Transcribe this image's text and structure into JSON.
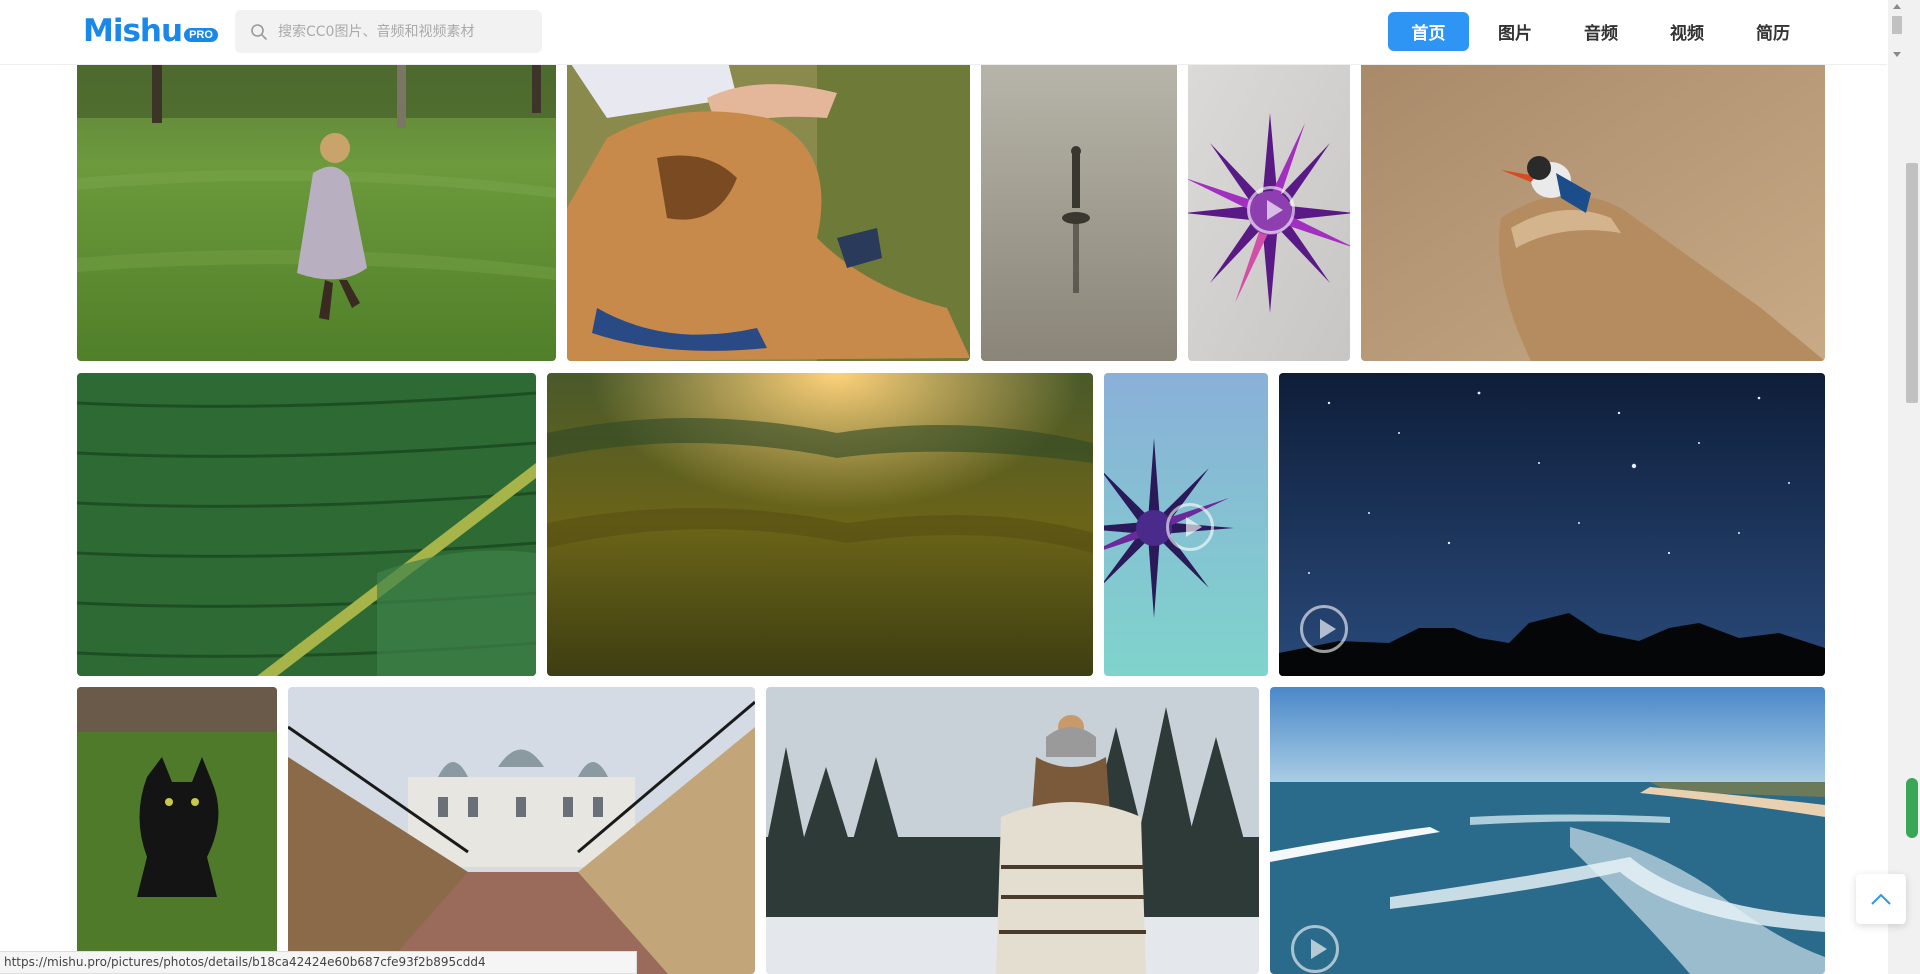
{
  "header": {
    "logo_text": "Mishu",
    "logo_badge": "PRO",
    "search_placeholder": "搜索CC0图片、音频和视频素材",
    "nav": [
      {
        "label": "首页",
        "active": true
      },
      {
        "label": "图片",
        "active": false
      },
      {
        "label": "音频",
        "active": false
      },
      {
        "label": "视频",
        "active": false
      },
      {
        "label": "简历",
        "active": false
      }
    ]
  },
  "gallery": {
    "tiles": [
      {
        "name": "tile-girl-running-grass",
        "kind": "photo"
      },
      {
        "name": "tile-dog-petting",
        "kind": "photo"
      },
      {
        "name": "tile-fisherman-lake",
        "kind": "photo"
      },
      {
        "name": "tile-purple-burst-video",
        "kind": "video"
      },
      {
        "name": "tile-kingfisher-rock",
        "kind": "photo"
      },
      {
        "name": "tile-palm-leaf",
        "kind": "photo"
      },
      {
        "name": "tile-forest-sunrise",
        "kind": "photo"
      },
      {
        "name": "tile-purple-burst-teal-video",
        "kind": "video"
      },
      {
        "name": "tile-starry-sky-video",
        "kind": "video"
      },
      {
        "name": "tile-black-cat",
        "kind": "photo"
      },
      {
        "name": "tile-palace-walkway",
        "kind": "photo"
      },
      {
        "name": "tile-woman-winter-forest",
        "kind": "photo"
      },
      {
        "name": "tile-ocean-beach-video",
        "kind": "video"
      }
    ]
  },
  "statusbar": {
    "url": "https://mishu.pro/pictures/photos/details/b18ca42424e60b687cfe93f2b895cdd4"
  },
  "colors": {
    "brand": "#1a88e8",
    "nav_active": "#2e95f5"
  }
}
